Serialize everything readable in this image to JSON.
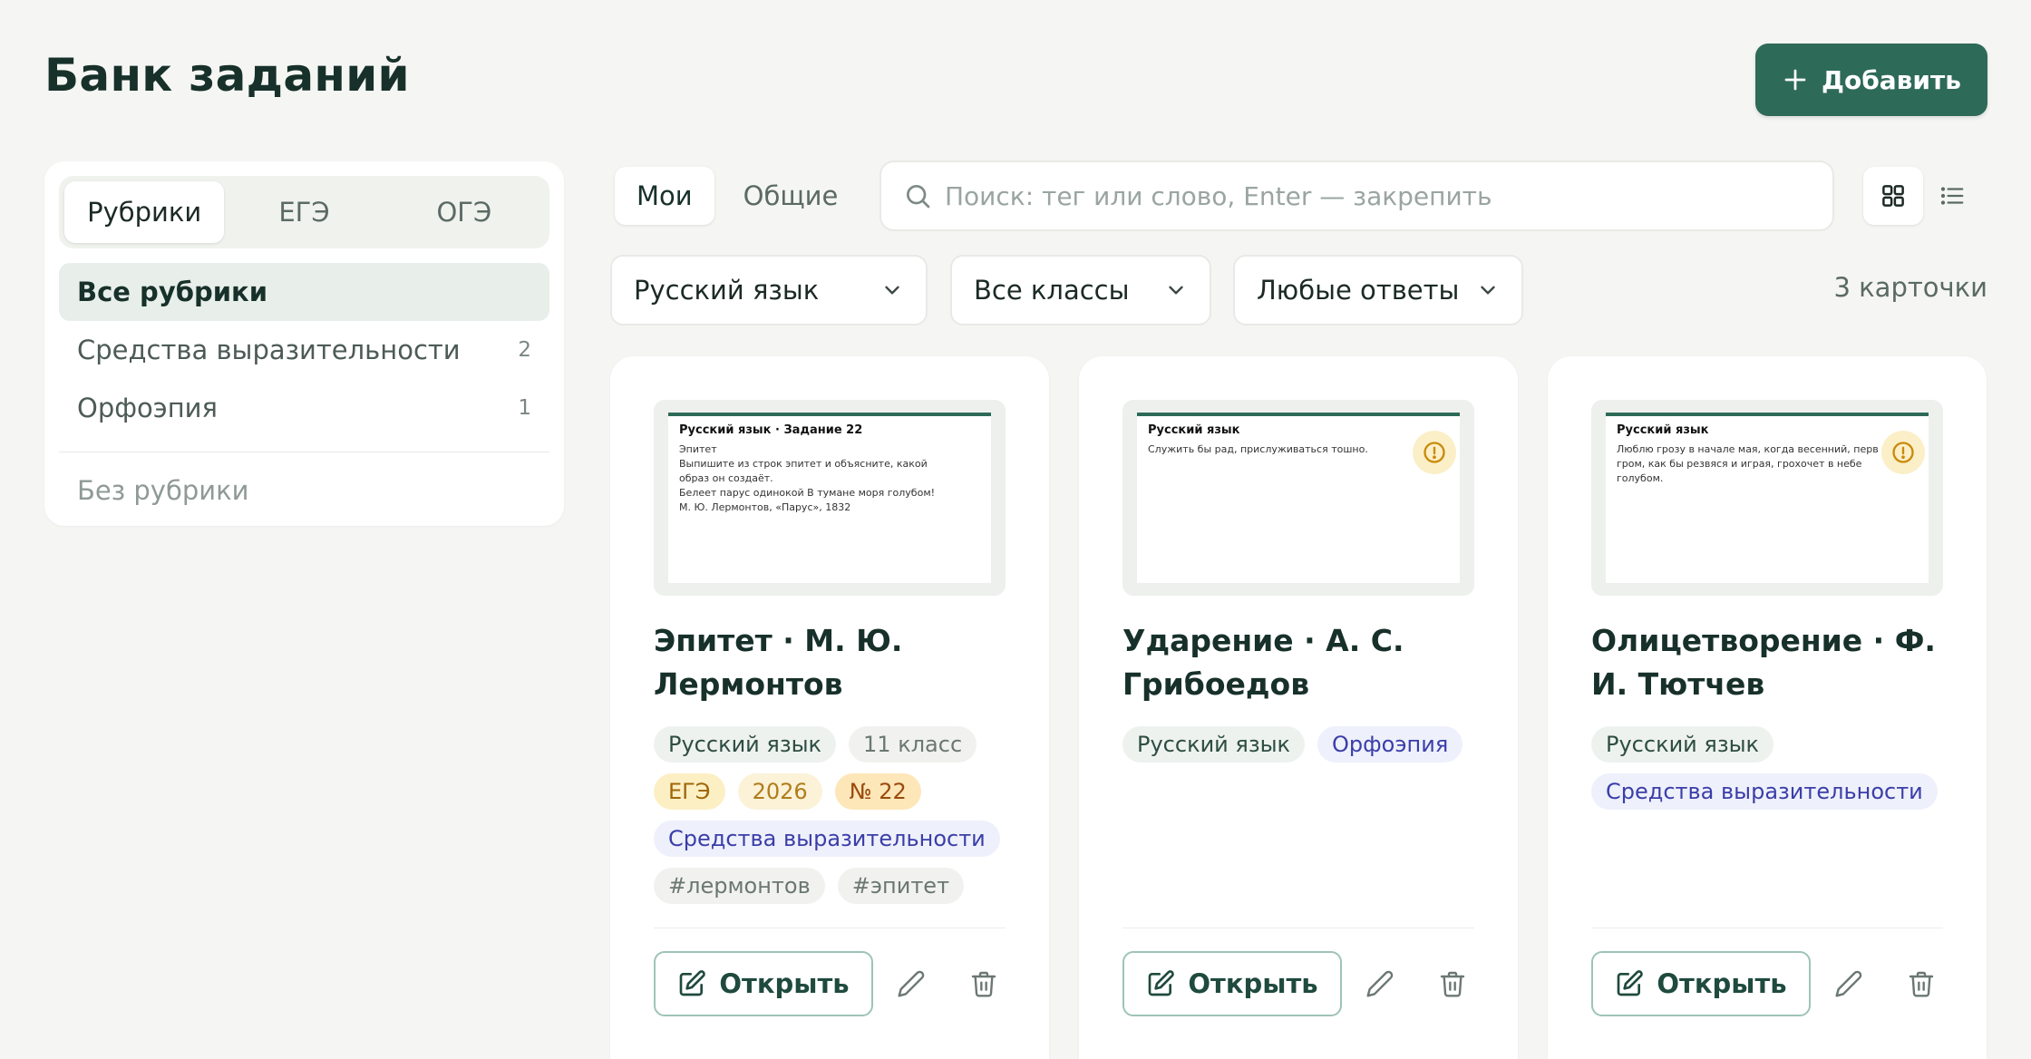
{
  "header": {
    "title": "Банк заданий",
    "add_label": "Добавить"
  },
  "sidebar": {
    "tabs": [
      {
        "label": "Рубрики",
        "active": true
      },
      {
        "label": "ЕГЭ",
        "active": false
      },
      {
        "label": "ОГЭ",
        "active": false
      }
    ],
    "items": [
      {
        "label": "Все рубрики",
        "count": "",
        "active": true
      },
      {
        "label": "Средства выразительности",
        "count": "2"
      },
      {
        "label": "Орфоэпия",
        "count": "1"
      }
    ],
    "no_rubric": "Без рубрики"
  },
  "toolbar": {
    "scope_tabs": [
      {
        "label": "Мои",
        "active": true
      },
      {
        "label": "Общие",
        "active": false
      }
    ],
    "search_placeholder": "Поиск: тег или слово, Enter — закрепить",
    "view_mode": "grid"
  },
  "filters": {
    "subject": "Русский язык",
    "grade": "Все классы",
    "answers": "Любые ответы",
    "card_count": "3 карточки"
  },
  "cards": [
    {
      "title": "Эпитет · М. Ю. Лермонтов",
      "preview_head": "Русский язык · Задание 22",
      "preview_lines": [
        "Эпитет",
        "Выпишите из строк эпитет и объясните, какой",
        "образ он создаёт.",
        "Белеет парус одинокой В тумане моря голубом!",
        "М. Ю. Лермонтов, «Парус», 1832"
      ],
      "warning": false,
      "tags": [
        {
          "text": "Русский язык",
          "kind": "subject"
        },
        {
          "text": "11 класс",
          "kind": "grade"
        },
        {
          "text": "ЕГЭ",
          "kind": "exam"
        },
        {
          "text": "2026",
          "kind": "year"
        },
        {
          "text": "№ 22",
          "kind": "num"
        },
        {
          "text": "Средства выразительности",
          "kind": "rubric"
        },
        {
          "text": "#лермонтов",
          "kind": "hashtag"
        },
        {
          "text": "#эпитет",
          "kind": "hashtag"
        }
      ],
      "open_label": "Открыть"
    },
    {
      "title": "Ударение · А. С. Грибоедов",
      "preview_head": "Русский язык",
      "preview_lines": [
        "Служить бы рад, прислуживаться тошно."
      ],
      "warning": true,
      "tags": [
        {
          "text": "Русский язык",
          "kind": "subject"
        },
        {
          "text": "Орфоэпия",
          "kind": "rubric"
        }
      ],
      "open_label": "Открыть"
    },
    {
      "title": "Олицетворение · Ф. И. Тютчев",
      "preview_head": "Русский язык",
      "preview_lines": [
        "Люблю грозу в начале мая, когда весенний, перв",
        "гром, как бы резвяся и играя, грохочет в небе",
        "голубом."
      ],
      "warning": true,
      "tags": [
        {
          "text": "Русский язык",
          "kind": "subject"
        },
        {
          "text": "Средства выразительности",
          "kind": "rubric"
        }
      ],
      "open_label": "Открыть"
    }
  ],
  "colors": {
    "accent": "#2e6a58",
    "background": "#f5f6f3",
    "warning": "#d89b0e"
  }
}
